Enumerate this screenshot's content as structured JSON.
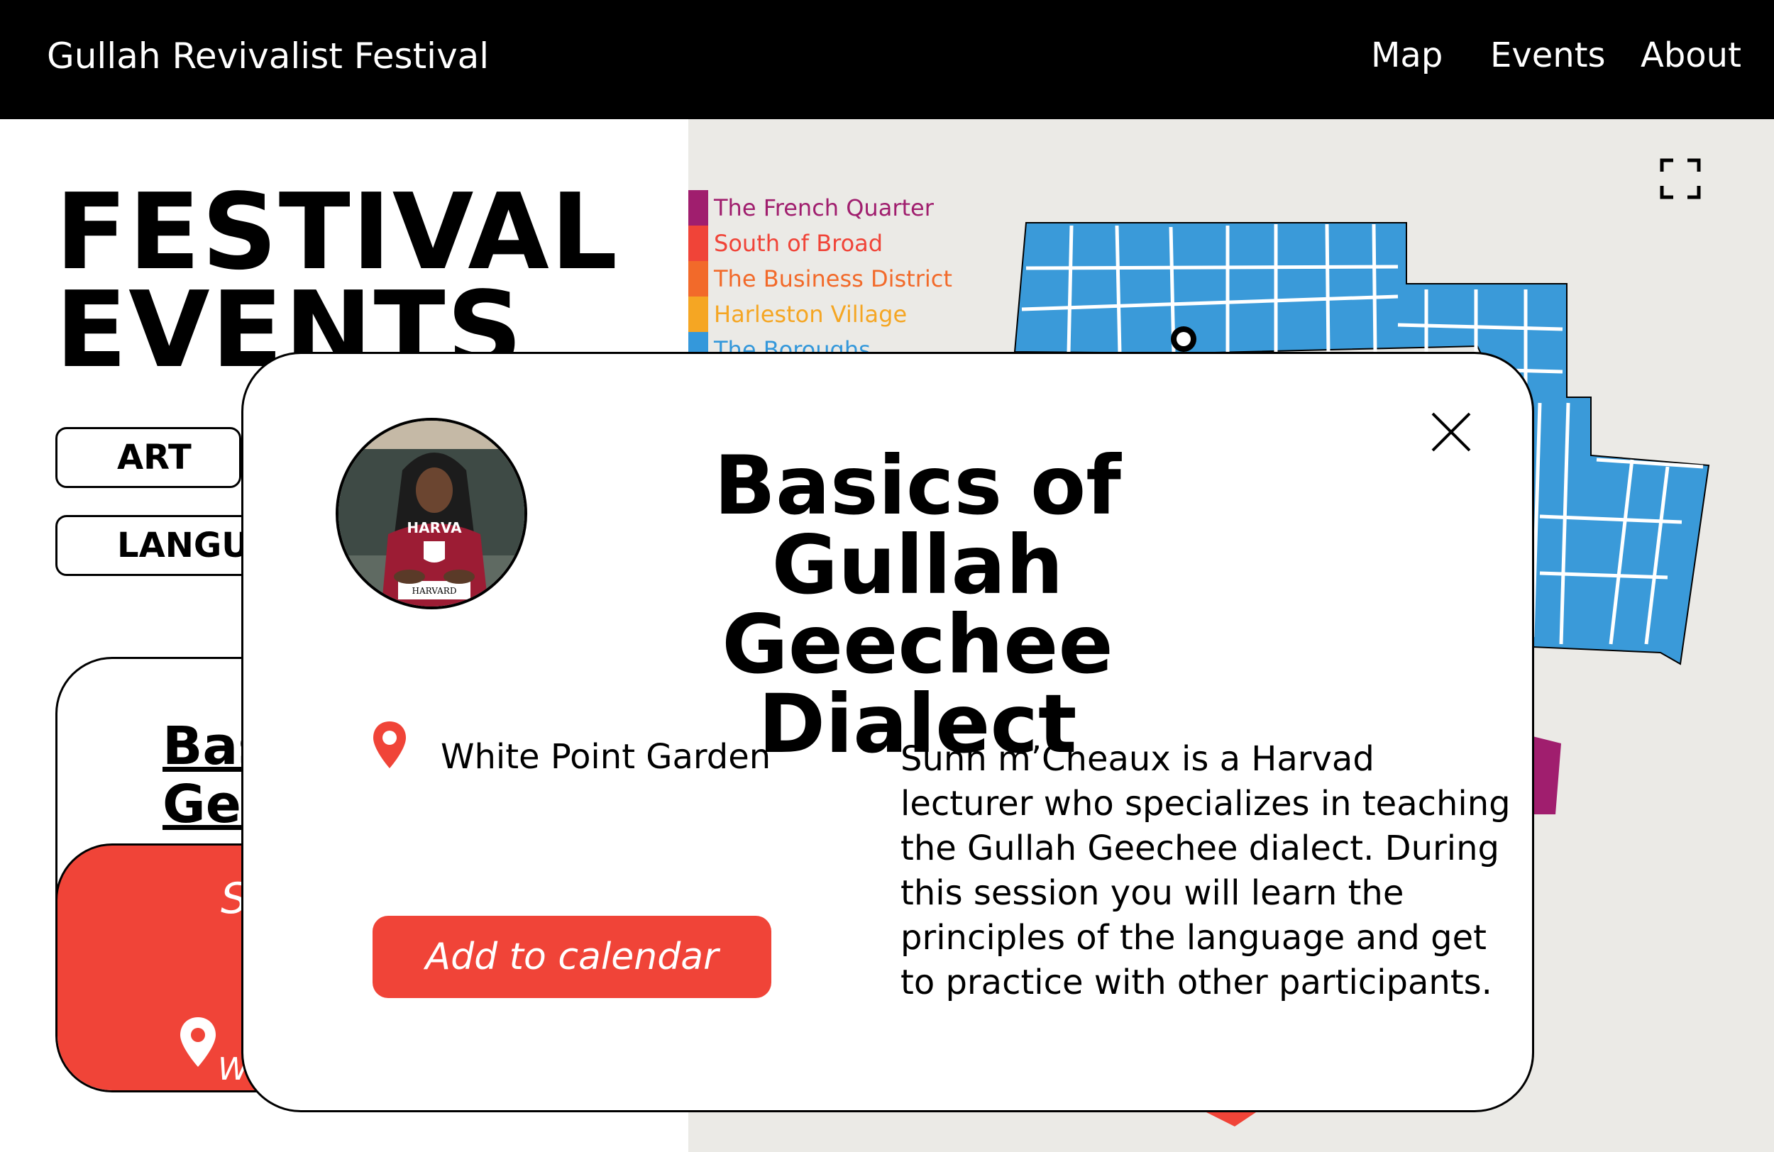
{
  "header": {
    "brand": "Gullah Revivalist Festival",
    "nav": [
      "Map",
      "Events",
      "About"
    ]
  },
  "page": {
    "title_line1": "FESTIVAL",
    "title_line2": "EVENTS",
    "filters": [
      "ART",
      "LANGUA"
    ]
  },
  "event_card": {
    "title_line1": "Bas",
    "title_line2": "Gee",
    "date": "S",
    "location": "W"
  },
  "map": {
    "legend": [
      {
        "label": "The French Quarter",
        "color": "#a01e6e"
      },
      {
        "label": "South of Broad",
        "color": "#f04438"
      },
      {
        "label": "The Business District",
        "color": "#f26a2a"
      },
      {
        "label": "Harleston Village",
        "color": "#f5a623"
      },
      {
        "label": "The Boroughs",
        "color": "#3498db"
      }
    ],
    "district_color": "#3a9ad9",
    "expand_icon": "fullscreen-icon"
  },
  "modal": {
    "title_line1": "Basics of Gullah",
    "title_line2": "Geechee Dialect",
    "location": "White Point Garden",
    "button": "Add to calendar",
    "description": "Sunn m’Cheaux is a Harvad lecturer who specializes in teaching the Gullah Geechee dialect. During this session you will learn the principles of the language and get to practice with other participants.",
    "avatar_shirt_text": "HARVA",
    "avatar_sign_text": "HARVARD",
    "accent_color": "#f04438"
  }
}
